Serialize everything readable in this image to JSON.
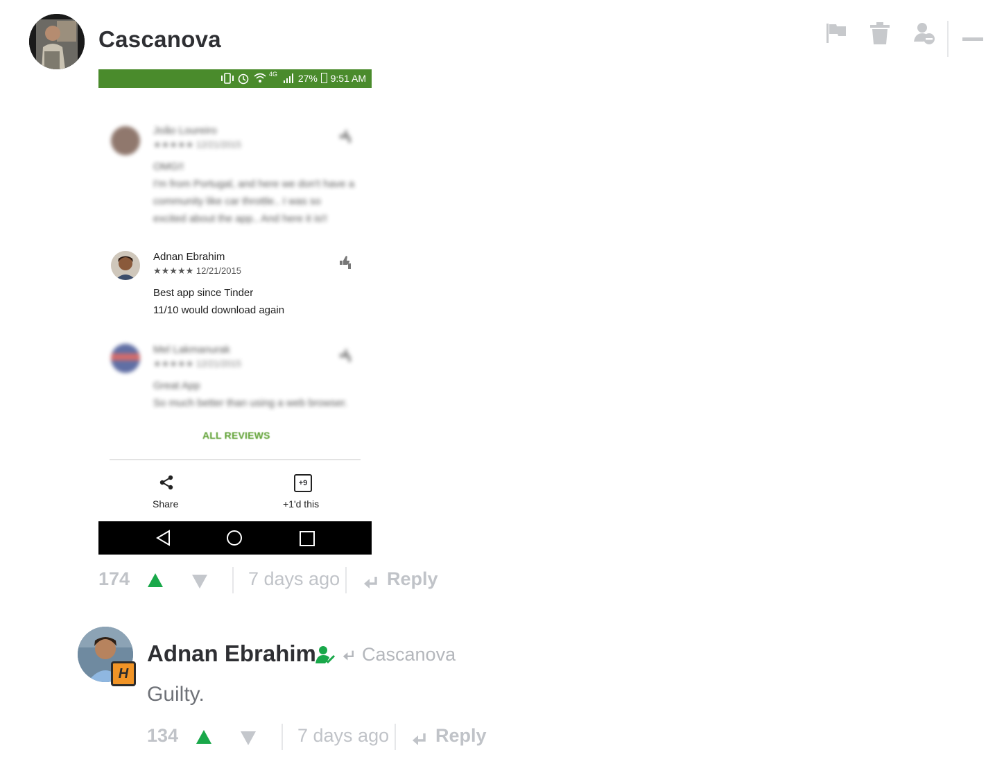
{
  "comment": {
    "author": "Cascanova",
    "moderation_icons": [
      "flag-icon",
      "trash-icon",
      "ban-user-icon",
      "collapse-icon"
    ],
    "footer": {
      "votes": "174",
      "timestamp": "7 days ago",
      "reply_label": "Reply"
    }
  },
  "phone_screenshot": {
    "status_bar": {
      "network": "4G",
      "battery": "27%",
      "time": "9:51 AM"
    },
    "reviews": [
      {
        "name": "João Loureiro",
        "stars": "★★★★★",
        "date": "12/21/2015",
        "title": "OMG!!",
        "text_lines": [
          "I'm from Portugal, and here we don't have a",
          "community like car throttle.. I was so",
          "excited about the app.. And here it is!!"
        ],
        "blurred": true
      },
      {
        "name": "Adnan Ebrahim",
        "stars": "★★★★★",
        "date": "12/21/2015",
        "title": "Best app since Tinder",
        "text_lines": [
          "11/10 would download again"
        ],
        "blurred": false
      },
      {
        "name": "Mel Lakmanurak",
        "stars": "★★★★★",
        "date": "12/21/2015",
        "title": "Great App",
        "text_lines": [
          "So much better than using a web browser."
        ],
        "blurred": true
      }
    ],
    "all_reviews_label": "ALL REVIEWS",
    "actions": {
      "share_label": "Share",
      "plus_one_badge": "+9",
      "plus_one_label": "+1'd this"
    },
    "accent_color": "#4a8b2c"
  },
  "reply": {
    "author": "Adnan Ebrahim",
    "replying_to": "Cascanova",
    "badge_text": "H",
    "body": "Guilty.",
    "footer": {
      "votes": "134",
      "timestamp": "7 days ago",
      "reply_label": "Reply"
    }
  },
  "colors": {
    "upvote": "#19a84a",
    "downvote": "#c4c7cc",
    "muted_text": "#c0c3c8",
    "author_text": "#2e2f33"
  }
}
